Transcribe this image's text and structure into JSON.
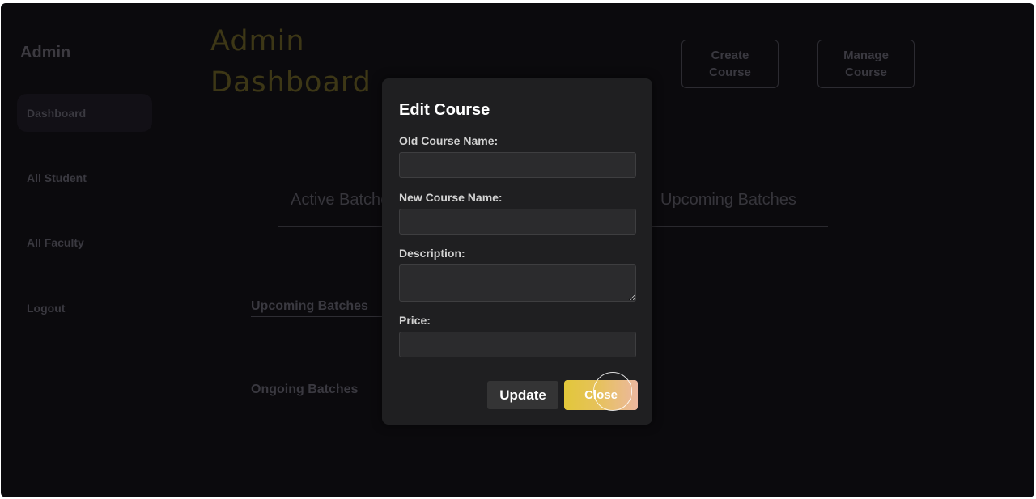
{
  "sidebar": {
    "title": "Admin",
    "items": [
      {
        "label": "Dashboard",
        "active": true
      },
      {
        "label": "All Student"
      },
      {
        "label": "All Faculty"
      },
      {
        "label": "Logout"
      }
    ]
  },
  "header": {
    "title": "Admin Dashboard",
    "buttons": [
      {
        "label": "Create\nCourse"
      },
      {
        "label": "Manage\nCourse"
      }
    ]
  },
  "tabs": [
    "Active Batches",
    "Upcoming Batches"
  ],
  "sections": [
    "Upcoming Batches",
    "Ongoing Batches"
  ],
  "modal": {
    "title": "Edit Course",
    "fields": [
      {
        "label": "Old Course Name:",
        "value": ""
      },
      {
        "label": "New Course Name:",
        "value": ""
      },
      {
        "label": "Description:",
        "value": ""
      },
      {
        "label": "Price:",
        "value": ""
      }
    ],
    "update_label": "Update",
    "close_label": "Close"
  },
  "colors": {
    "background": "#0b0a0d",
    "modal": "#1f1f21",
    "title_gold": "#3d3716",
    "close_gradient_start": "#e2c73a",
    "close_gradient_end": "#ecb8a0"
  }
}
